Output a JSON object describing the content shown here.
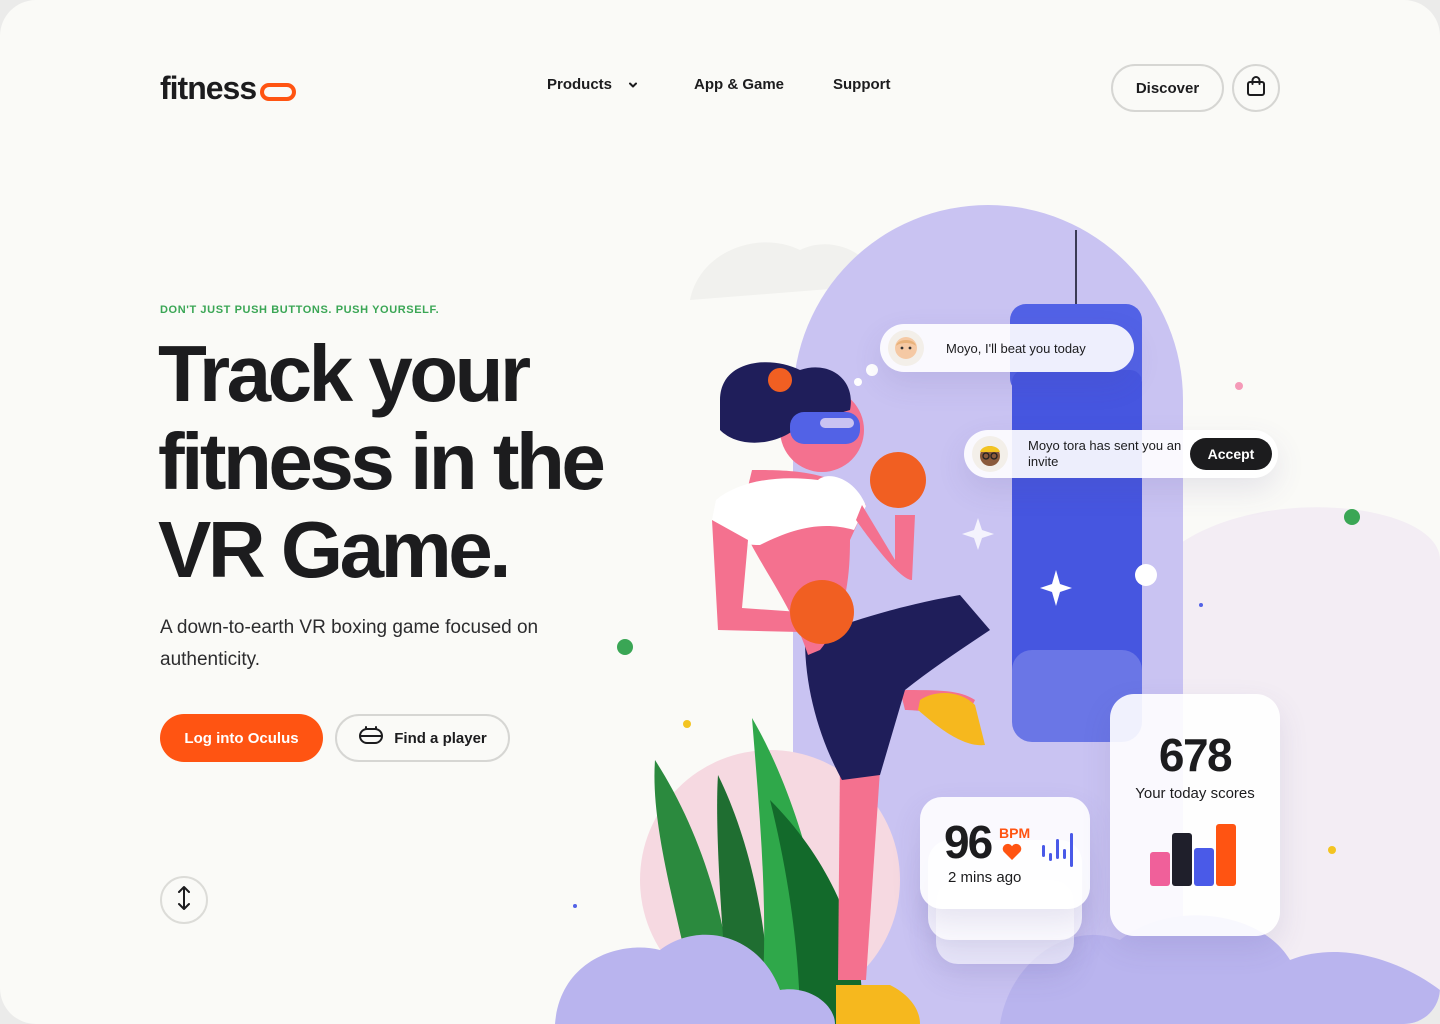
{
  "brand": {
    "name": "fitness",
    "accent": "#ff5412"
  },
  "nav": {
    "items": [
      {
        "label": "Products",
        "has_dropdown": true,
        "icon": "chevron-down-icon"
      },
      {
        "label": "App & Game"
      },
      {
        "label": "Support"
      }
    ],
    "discover_label": "Discover",
    "cart_icon": "shopping-bag-icon"
  },
  "hero": {
    "eyebrow": "DON'T JUST PUSH BUTTONS. PUSH YOURSELF.",
    "headline_line1": "Track your",
    "headline_line2": "fitness in the",
    "headline_line3": "VR Game.",
    "subtitle": "A down-to-earth VR boxing game focused on authenticity.",
    "primary_cta": "Log into Oculus",
    "secondary_cta": "Find a player",
    "secondary_icon": "vr-headset-icon",
    "scroll_icon": "vertical-arrows-icon"
  },
  "chat": {
    "message1": "Moyo, I'll beat you today",
    "message2": "Moyo tora has sent you an invite",
    "accept_label": "Accept"
  },
  "heart_rate": {
    "value": "96",
    "unit": "BPM",
    "time": "2 mins ago"
  },
  "score": {
    "value": "678",
    "label": "Your today scores",
    "bars": [
      {
        "value": 0.55,
        "color": "#f0609a"
      },
      {
        "value": 0.85,
        "color": "#1f1f2b"
      },
      {
        "value": 0.62,
        "color": "#4a5ae8"
      },
      {
        "value": 1.0,
        "color": "#ff5412"
      }
    ]
  },
  "colors": {
    "green": "#3aa655",
    "purple": "#c9c3f2",
    "bag_blue": "#4a5ae8",
    "dark": "#1c1c1e"
  }
}
